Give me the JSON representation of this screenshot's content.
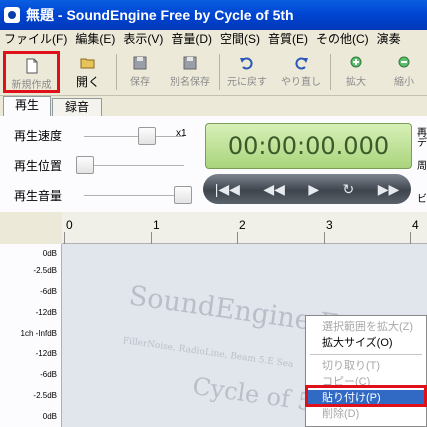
{
  "window": {
    "title": "無題 - SoundEngine Free by Cycle of 5th"
  },
  "menubar": [
    "ファイル(F)",
    "編集(E)",
    "表示(V)",
    "音量(D)",
    "空間(S)",
    "音質(E)",
    "その他(C)",
    "演奏"
  ],
  "toolbar": {
    "new": "新規作成",
    "open": "開く",
    "save": "保存",
    "save_as": "別名保存",
    "undo": "元に戻す",
    "redo": "やり直し",
    "zoom_in": "拡大",
    "zoom_out": "縮小"
  },
  "tabs": {
    "play": "再生",
    "record": "録音"
  },
  "controls": {
    "speed_label": "再生速度",
    "position_label": "再生位置",
    "volume_label": "再生音量",
    "speed_suffix": "x1",
    "time": "00:00:00.000",
    "right_label_1": "再",
    "right_label_1b": "デ",
    "right_label_2": "周",
    "right_label_3": "ビ"
  },
  "ruler": [
    "0",
    "1",
    "2",
    "3",
    "4"
  ],
  "db_labels": [
    "0dB",
    "-2.5dB",
    "-6dB",
    "-12dB",
    "1ch -InfdB",
    "-12dB",
    "-6dB",
    "-2.5dB",
    "0dB"
  ],
  "watermark": {
    "line1": "SoundEngine Free",
    "line2": "FillerNoise, RadioLine, Beam 5.E Sea",
    "line3": "Cycle of 5th"
  },
  "context_menu": {
    "items": [
      {
        "label": "選択範囲を拡大(Z)",
        "enabled": false
      },
      {
        "label": "拡大サイズ(O)",
        "enabled": true
      },
      {
        "label": "切り取り(T)",
        "enabled": false
      },
      {
        "label": "コピー(C)",
        "enabled": false
      },
      {
        "label": "貼り付け(P)",
        "enabled": true,
        "selected": true
      },
      {
        "label": "削除(D)",
        "enabled": false
      }
    ]
  },
  "colors": {
    "titlebar": "#0046d4",
    "highlight_box": "#e0101a",
    "menu_selection": "#316ac5",
    "lcd": "#a9d47c"
  }
}
